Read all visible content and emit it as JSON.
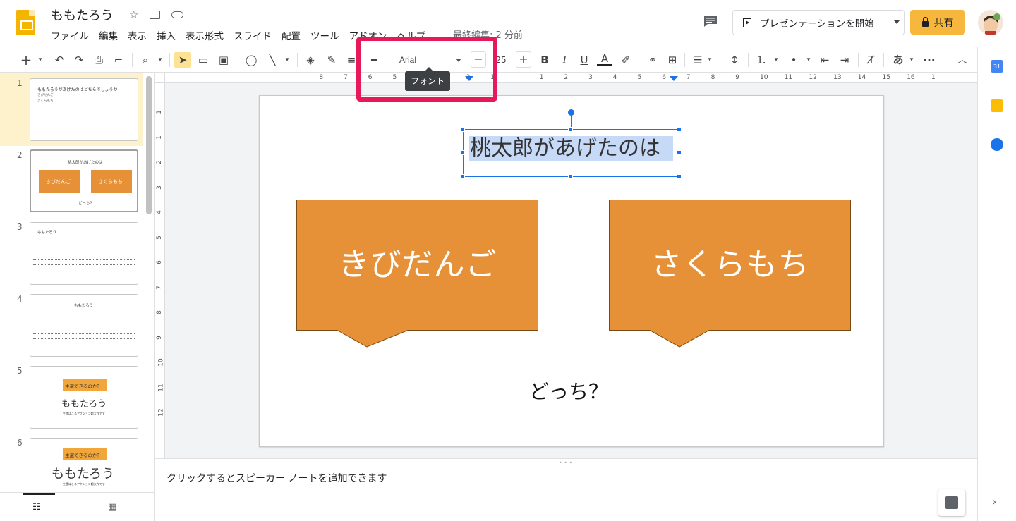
{
  "app": {
    "title": "ももたろう",
    "menu": [
      "ファイル",
      "編集",
      "表示",
      "挿入",
      "表示形式",
      "スライド",
      "配置",
      "ツール",
      "アドオン",
      "ヘルプ"
    ],
    "last_edit": "最終編集: 2 分前",
    "present_label": "プレゼンテーションを開始",
    "share_label": "共有"
  },
  "toolbar": {
    "font_name": "Arial",
    "font_size": "25",
    "minus": "−",
    "plus": "+",
    "bold": "B",
    "italic": "I",
    "underline": "U",
    "text_color": "A",
    "input_tools": "あ",
    "more": "···",
    "tooltip": "フォント"
  },
  "slides": [
    {
      "number": "1",
      "title": "ももたろうがあげたのはどちらでしょうか",
      "lines": [
        "きびだんご",
        "さくらもち"
      ]
    },
    {
      "number": "2",
      "title": "桃太郎があげたのは",
      "a": "きびだんご",
      "b": "さくらもち",
      "q": "どっち？"
    },
    {
      "number": "3",
      "title": "ももたろう"
    },
    {
      "number": "4",
      "title": "ももたろう"
    },
    {
      "number": "5",
      "tag": "生還できるのか？",
      "title": "ももたろう",
      "sub": "生還はこるアクション超大作です"
    },
    {
      "number": "6",
      "tag": "生還できるのか？",
      "title": "ももたろう",
      "sub": "生還はこるアクション超大作です"
    }
  ],
  "slide_main": {
    "title": "桃太郎があげたのは",
    "callout_left": "きびだんご",
    "callout_right": "さくらもち",
    "question": "どっち？",
    "callout_color": "#e69138"
  },
  "ruler": {
    "h_left": [
      "8",
      "7",
      "6",
      "5",
      "4",
      "3",
      "2",
      "1"
    ],
    "h_right": [
      "1",
      "2",
      "3",
      "4",
      "5",
      "6",
      "7",
      "8",
      "9",
      "10",
      "11",
      "12",
      "13",
      "14",
      "15",
      "16",
      "1"
    ],
    "v": [
      "1",
      "1",
      "2",
      "3",
      "4",
      "5",
      "6",
      "7",
      "8",
      "9",
      "10",
      "11",
      "12"
    ]
  },
  "notes": {
    "placeholder": "クリックするとスピーカー ノートを追加できます"
  },
  "side_panel": {
    "calendar_day": "31"
  }
}
